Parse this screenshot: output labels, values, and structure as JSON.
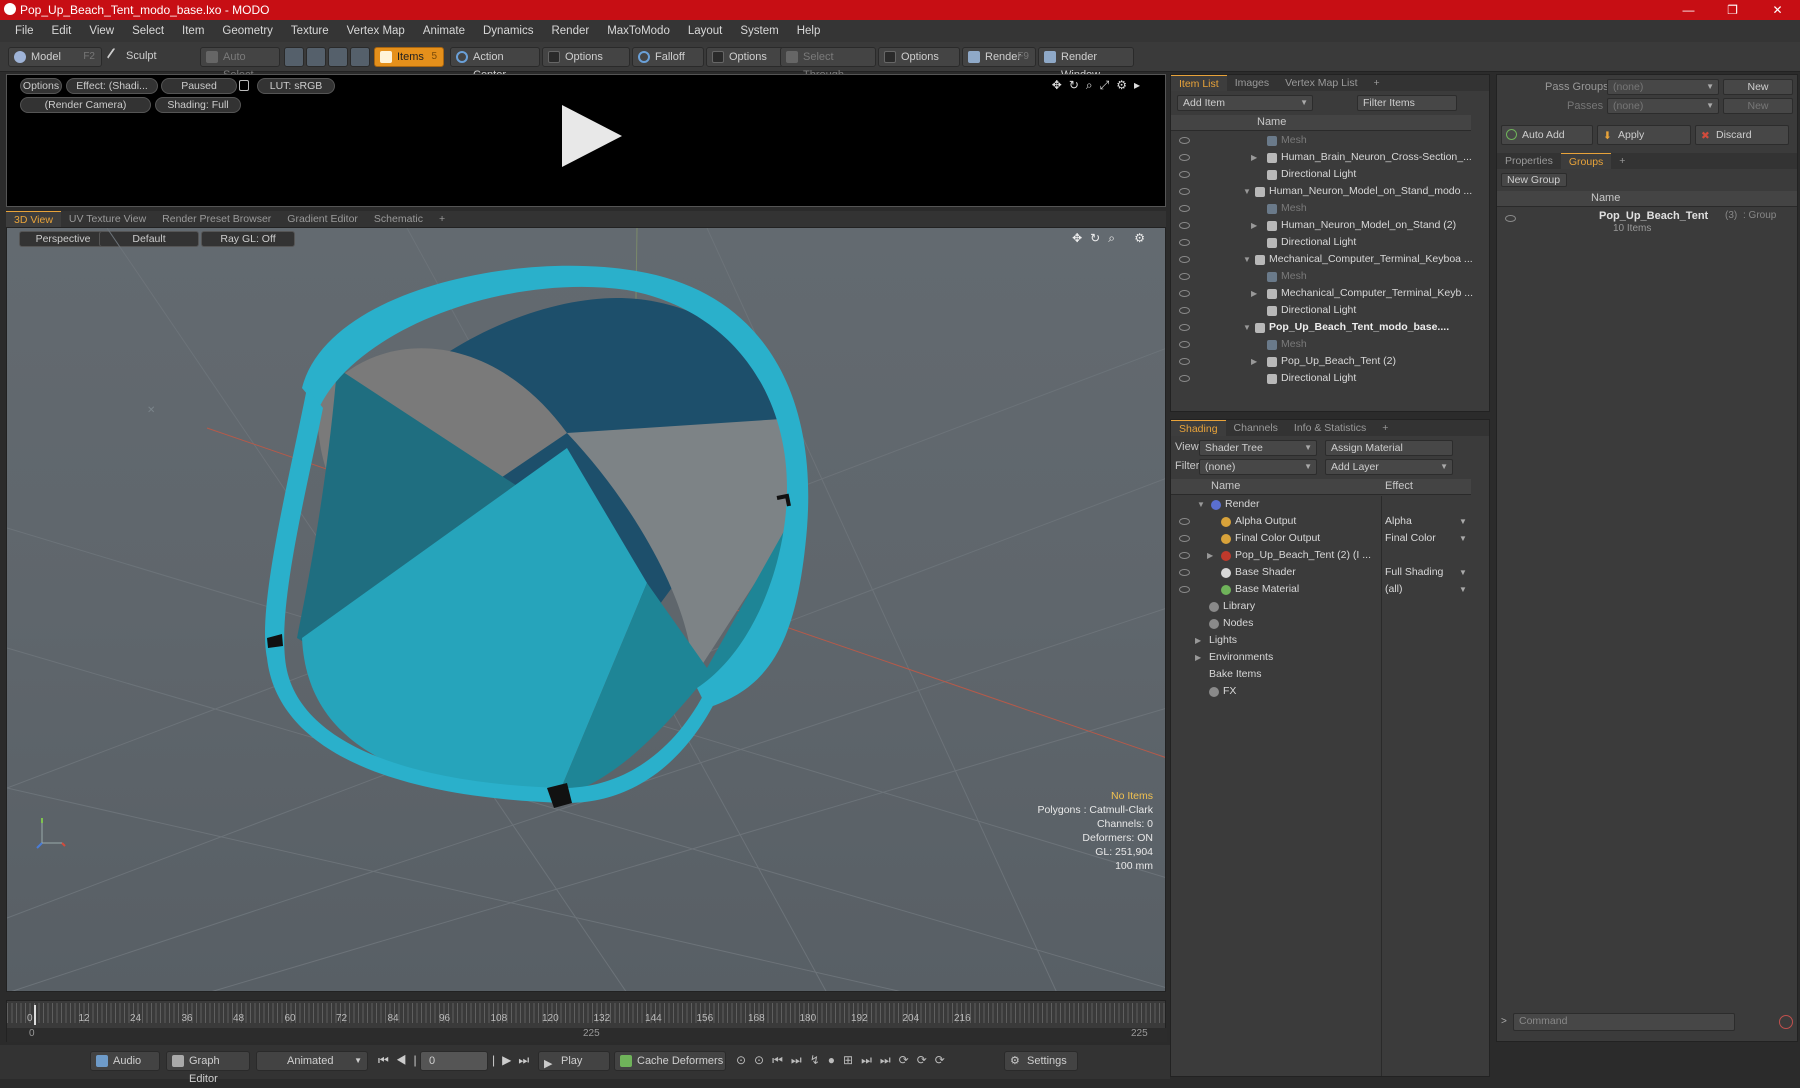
{
  "window": {
    "title": "Pop_Up_Beach_Tent_modo_base.lxo - MODO",
    "minimize": "—",
    "maximize": "❐",
    "close": "✕"
  },
  "menu": [
    "File",
    "Edit",
    "View",
    "Select",
    "Item",
    "Geometry",
    "Texture",
    "Vertex Map",
    "Animate",
    "Dynamics",
    "Render",
    "MaxToModo",
    "Layout",
    "System",
    "Help"
  ],
  "toolbar": {
    "model": "Model",
    "model_sc": "F2",
    "sculpt": "Sculpt",
    "auto_select": "Auto Select",
    "items": "Items",
    "items_sc": "5",
    "action_center": "Action Center",
    "options1": "Options",
    "falloff": "Falloff",
    "options2": "Options",
    "select_through": "Select Through",
    "options3": "Options",
    "render": "Render",
    "render_sc": "F9",
    "render_window": "Render Window"
  },
  "preview": {
    "options": "Options",
    "effect": "Effect: (Shadi...",
    "paused": "Paused",
    "lut": "LUT: sRGB",
    "camera": "(Render Camera)",
    "shading": "Shading: Full"
  },
  "viewport_tabs": [
    "3D View",
    "UV Texture View",
    "Render Preset Browser",
    "Gradient Editor",
    "Schematic",
    "+"
  ],
  "viewport": {
    "perspective": "Perspective",
    "default": "Default",
    "raygl": "Ray GL: Off"
  },
  "hud": {
    "no_items": "No Items",
    "polygons": "Polygons : Catmull-Clark",
    "channels": "Channels: 0",
    "deformers": "Deformers: ON",
    "gl": "GL: 251,904",
    "scale": "100 mm"
  },
  "timeline": {
    "ticks": [
      "0",
      "12",
      "24",
      "36",
      "48",
      "60",
      "72",
      "84",
      "96",
      "108",
      "120",
      "132",
      "144",
      "156",
      "168",
      "180",
      "192",
      "204",
      "216"
    ],
    "start": "0",
    "mid": "225",
    "end": "225"
  },
  "bottombar": {
    "audio": "Audio",
    "graph_editor": "Graph Editor",
    "animated": "Animated",
    "frame": "0",
    "play": "Play",
    "cache_deformers": "Cache Deformers",
    "settings": "Settings"
  },
  "itemlist": {
    "tabs": [
      "Item List",
      "Images",
      "Vertex Map List",
      "+"
    ],
    "add_item": "Add Item",
    "filter_items": "Filter Items",
    "col_name": "Name",
    "rows": [
      {
        "label": "Mesh",
        "indent": 2,
        "dim": true,
        "bold": false,
        "tri": ""
      },
      {
        "label": "Human_Brain_Neuron_Cross-Section_...",
        "indent": 2,
        "dim": false,
        "bold": false,
        "tri": "▶"
      },
      {
        "label": "Directional Light",
        "indent": 2,
        "dim": false,
        "bold": false,
        "tri": ""
      },
      {
        "label": "Human_Neuron_Model_on_Stand_modo ...",
        "indent": 1,
        "dim": false,
        "bold": false,
        "tri": "▼"
      },
      {
        "label": "Mesh",
        "indent": 2,
        "dim": true,
        "bold": false,
        "tri": ""
      },
      {
        "label": "Human_Neuron_Model_on_Stand (2)",
        "indent": 2,
        "dim": false,
        "bold": false,
        "tri": "▶"
      },
      {
        "label": "Directional Light",
        "indent": 2,
        "dim": false,
        "bold": false,
        "tri": ""
      },
      {
        "label": "Mechanical_Computer_Terminal_Keyboa ...",
        "indent": 1,
        "dim": false,
        "bold": false,
        "tri": "▼"
      },
      {
        "label": "Mesh",
        "indent": 2,
        "dim": true,
        "bold": false,
        "tri": ""
      },
      {
        "label": "Mechanical_Computer_Terminal_Keyb ...",
        "indent": 2,
        "dim": false,
        "bold": false,
        "tri": "▶"
      },
      {
        "label": "Directional Light",
        "indent": 2,
        "dim": false,
        "bold": false,
        "tri": ""
      },
      {
        "label": "Pop_Up_Beach_Tent_modo_base....",
        "indent": 1,
        "dim": false,
        "bold": true,
        "tri": "▼"
      },
      {
        "label": "Mesh",
        "indent": 2,
        "dim": true,
        "bold": false,
        "tri": ""
      },
      {
        "label": "Pop_Up_Beach_Tent (2)",
        "indent": 2,
        "dim": false,
        "bold": false,
        "tri": "▶"
      },
      {
        "label": "Directional Light",
        "indent": 2,
        "dim": false,
        "bold": false,
        "tri": ""
      }
    ]
  },
  "shading": {
    "tabs": [
      "Shading",
      "Channels",
      "Info & Statistics",
      "+"
    ],
    "view_label": "View",
    "view_value": "Shader Tree",
    "assign_material": "Assign Material",
    "filter_label": "Filter",
    "filter_value": "(none)",
    "add_layer": "Add Layer",
    "col_name": "Name",
    "col_effect": "Effect",
    "rows": [
      {
        "label": "Render",
        "effect": "",
        "indent": 0,
        "color": "#5a6fd0",
        "tri": "▼",
        "eye": false
      },
      {
        "label": "Alpha Output",
        "effect": "Alpha",
        "indent": 1,
        "color": "#d8a23a",
        "tri": "",
        "eye": true
      },
      {
        "label": "Final Color Output",
        "effect": "Final Color",
        "indent": 1,
        "color": "#d8a23a",
        "tri": "",
        "eye": true
      },
      {
        "label": "Pop_Up_Beach_Tent (2) (I ...",
        "effect": "",
        "indent": 1,
        "color": "#c0392b",
        "tri": "▶",
        "eye": true
      },
      {
        "label": "Base Shader",
        "effect": "Full Shading",
        "indent": 1,
        "color": "#d8d8d8",
        "tri": "",
        "eye": true
      },
      {
        "label": "Base Material",
        "effect": "(all)",
        "indent": 1,
        "color": "#6fb35a",
        "tri": "",
        "eye": true
      },
      {
        "label": "Library",
        "effect": "",
        "indent": 0,
        "color": "#8a8a8a",
        "tri": "",
        "eye": false
      },
      {
        "label": "Nodes",
        "effect": "",
        "indent": 0,
        "color": "#8a8a8a",
        "tri": "",
        "eye": false
      },
      {
        "label": "Lights",
        "effect": "",
        "indent": 0,
        "color": "",
        "tri": "▶",
        "eye": false
      },
      {
        "label": "Environments",
        "effect": "",
        "indent": 0,
        "color": "",
        "tri": "▶",
        "eye": false
      },
      {
        "label": "Bake Items",
        "effect": "",
        "indent": 0,
        "color": "",
        "tri": "",
        "eye": false
      },
      {
        "label": "FX",
        "effect": "",
        "indent": 0,
        "color": "#8a8a8a",
        "tri": "",
        "eye": false
      }
    ]
  },
  "groups_panel": {
    "pass_groups": "Pass Groups",
    "passes": "Passes",
    "none": "(none)",
    "new": "New",
    "auto_add": "Auto Add",
    "apply": "Apply",
    "discard": "Discard",
    "tabs": [
      "Properties",
      "Groups",
      "+"
    ],
    "new_group": "New Group",
    "col_name": "Name",
    "group_name": "Pop_Up_Beach_Tent",
    "group_count": "(3)",
    "group_type": ": Group",
    "group_items": "10 Items"
  },
  "command": {
    "placeholder": "Command"
  }
}
